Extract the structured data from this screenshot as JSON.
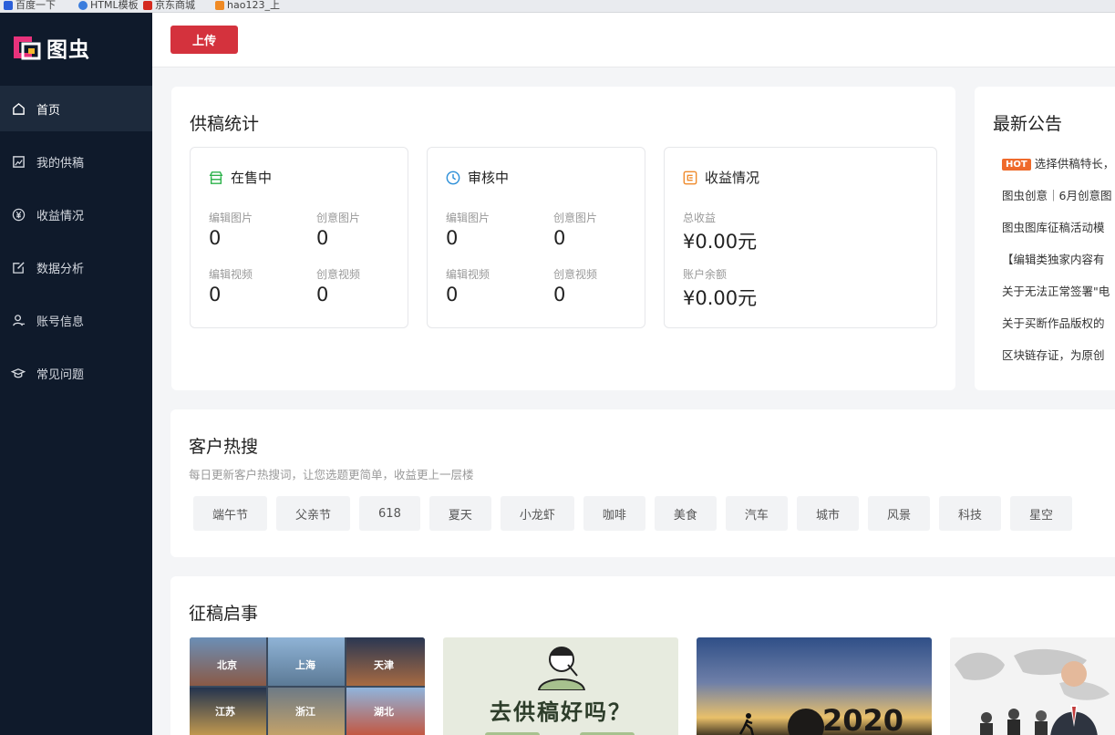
{
  "browser": {
    "bookmarks": [
      "百度一下",
      "HTML模板",
      "京东商城",
      "hao123_上"
    ]
  },
  "brand": {
    "name": "图虫",
    "colors": {
      "accent": "#d4323d",
      "sidebar": "#0f1a2b"
    }
  },
  "sidebar": {
    "items": [
      {
        "label": "首页",
        "icon": "home-icon",
        "active": true
      },
      {
        "label": "我的供稿",
        "icon": "image-icon"
      },
      {
        "label": "收益情况",
        "icon": "yen-icon"
      },
      {
        "label": "数据分析",
        "icon": "edit-icon"
      },
      {
        "label": "账号信息",
        "icon": "user-icon"
      },
      {
        "label": "常见问题",
        "icon": "graduation-cap-icon"
      }
    ]
  },
  "toolbar": {
    "upload_label": "上传"
  },
  "supply_stats": {
    "title": "供稿统计",
    "on_sale": {
      "title": "在售中",
      "edit_images_label": "编辑图片",
      "edit_images_value": "0",
      "creative_images_label": "创意图片",
      "creative_images_value": "0",
      "edit_videos_label": "编辑视频",
      "edit_videos_value": "0",
      "creative_videos_label": "创意视频",
      "creative_videos_value": "0"
    },
    "reviewing": {
      "title": "审核中",
      "edit_images_label": "编辑图片",
      "edit_images_value": "0",
      "creative_images_label": "创意图片",
      "creative_images_value": "0",
      "edit_videos_label": "编辑视频",
      "edit_videos_value": "0",
      "creative_videos_label": "创意视频",
      "creative_videos_value": "0"
    },
    "earnings": {
      "title": "收益情况",
      "total_label": "总收益",
      "total_value": "¥0.00元",
      "balance_label": "账户余额",
      "balance_value": "¥0.00元"
    }
  },
  "announcements": {
    "title": "最新公告",
    "hot_badge": "HOT",
    "items": [
      "选择供稿特长，",
      "图虫创意｜6月创意图",
      "图虫图库征稿活动模",
      "【编辑类独家内容有",
      "关于无法正常签署\"电",
      "关于买断作品版权的",
      "区块链存证，为原创"
    ]
  },
  "hot_search": {
    "title": "客户热搜",
    "subtitle": "每日更新客户热搜词，让您选题更简单，收益更上一层楼",
    "tags": [
      "端午节",
      "父亲节",
      "618",
      "夏天",
      "小龙虾",
      "咖啡",
      "美食",
      "汽车",
      "城市",
      "风景",
      "科技",
      "星空"
    ]
  },
  "call_for_submissions": {
    "title": "征稿启事",
    "cards": [
      {
        "cities": [
          "北京",
          "上海",
          "天津",
          "江苏",
          "浙江",
          "湖北"
        ]
      },
      {
        "headline": "去供稿好吗？"
      },
      {
        "headline": "2020"
      },
      {
        "headline": ""
      }
    ]
  }
}
